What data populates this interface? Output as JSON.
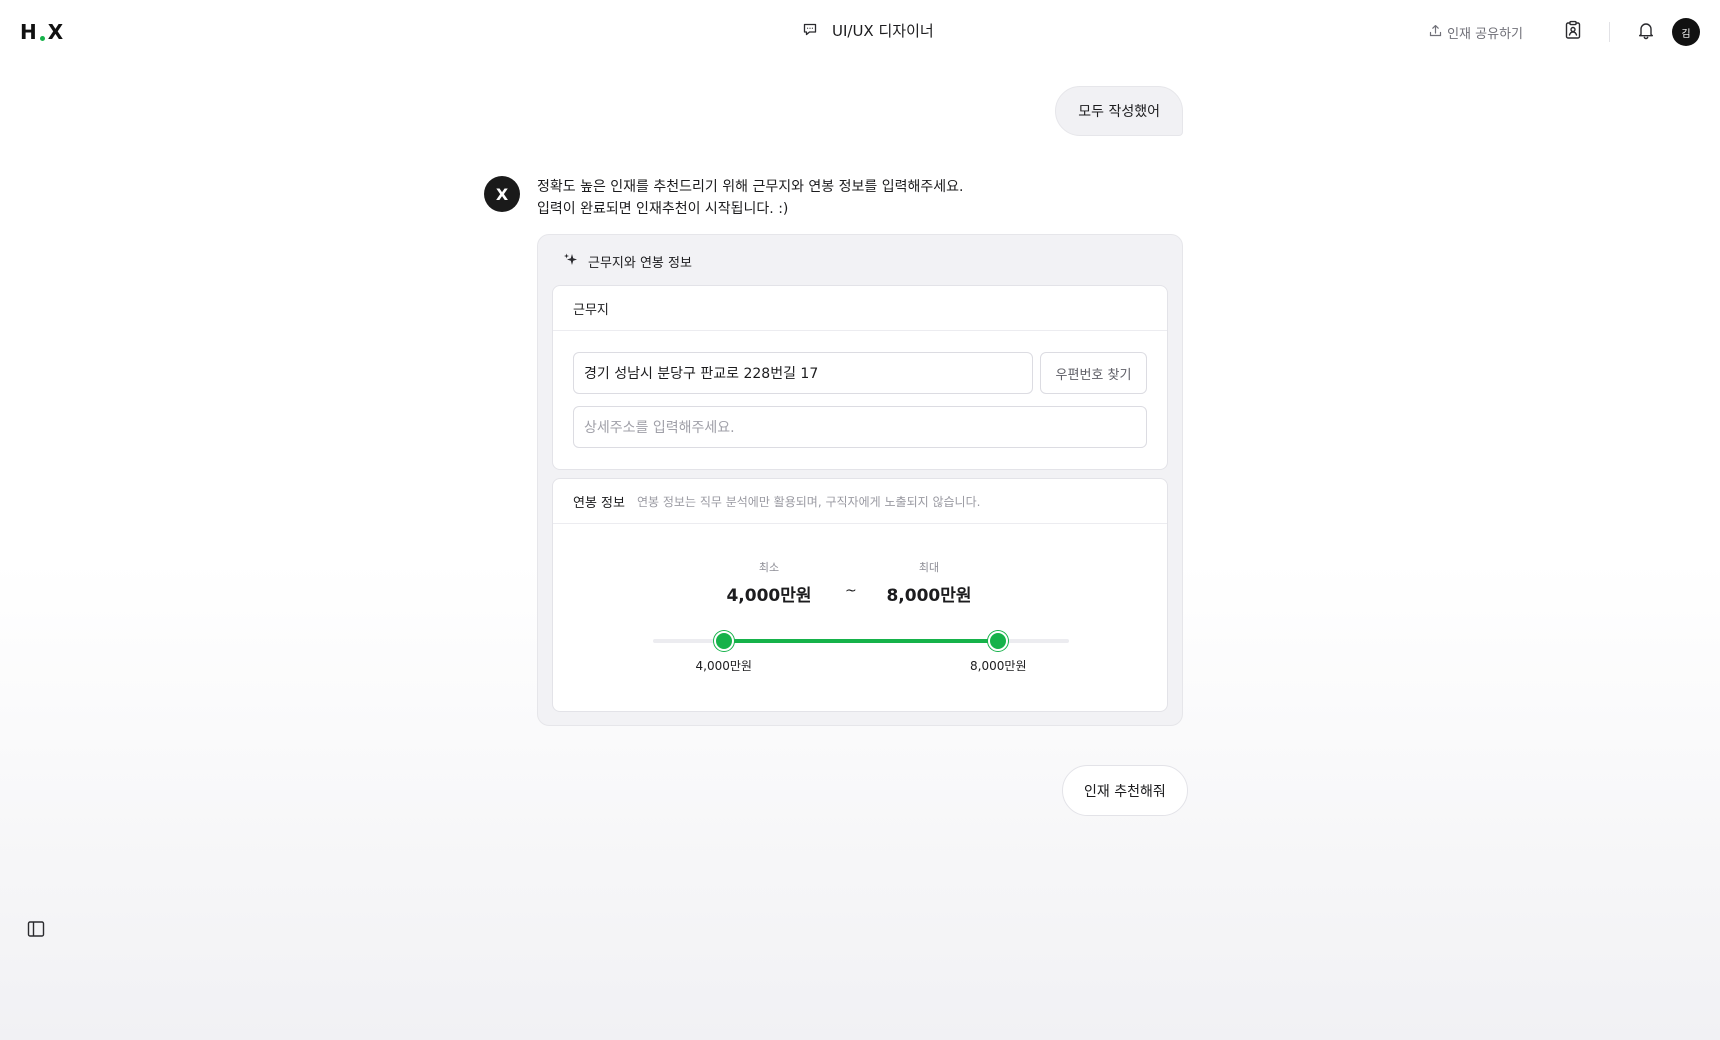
{
  "header": {
    "logo_left": "H",
    "logo_right": "X",
    "title": "UI/UX 디자이너",
    "title_icon": "chat-bubble-icon",
    "share_label": "인재 공유하기",
    "avatar_initial": "김"
  },
  "chat": {
    "user_message": "모두 작성했어",
    "bot_avatar": "X",
    "bot_lines": [
      "정확도 높은 인재를 추천드리기 위해 근무지와 연봉 정보를 입력해주세요.",
      "입력이 완료되면 인재추천이 시작됩니다. :)"
    ],
    "card": {
      "title": "근무지와 연봉 정보",
      "workplace": {
        "title": "근무지",
        "address_value": "경기 성남시 분당구 판교로 228번길 17",
        "zip_button": "우편번호 찾기",
        "detail_placeholder": "상세주소를 입력해주세요."
      },
      "salary": {
        "title": "연봉 정보",
        "hint": "연봉 정보는 직무 분석에만 활용되며, 구직자에게 노출되지 않습니다.",
        "min_label": "최소",
        "max_label": "최대",
        "min_value": "4,000만원",
        "max_value": "8,000만원",
        "separator": "~",
        "slider": {
          "min_fraction": 0.17,
          "max_fraction": 0.83,
          "min_thumb_label": "4,000만원",
          "max_thumb_label": "8,000만원"
        }
      }
    },
    "recommend_button": "인재 추천해줘"
  },
  "colors": {
    "accent": "#16b24a",
    "dark": "#1a1a1a"
  }
}
